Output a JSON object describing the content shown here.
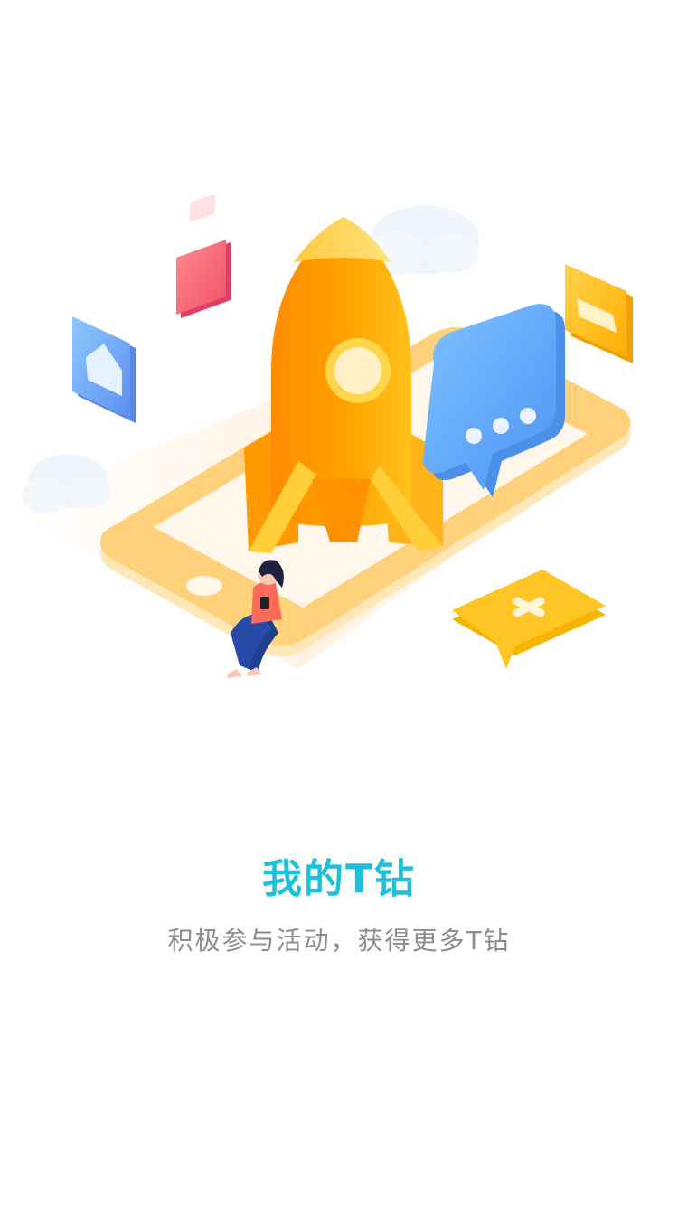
{
  "hero": {
    "title": "我的T钻",
    "subtitle": "积极参与活动，获得更多T钻"
  },
  "colors": {
    "title": "#1cc0da",
    "subtitle": "#8c8c8c",
    "rocket": "#ffa000",
    "phone": "#ffd37a",
    "bubble": "#6aaefc"
  }
}
